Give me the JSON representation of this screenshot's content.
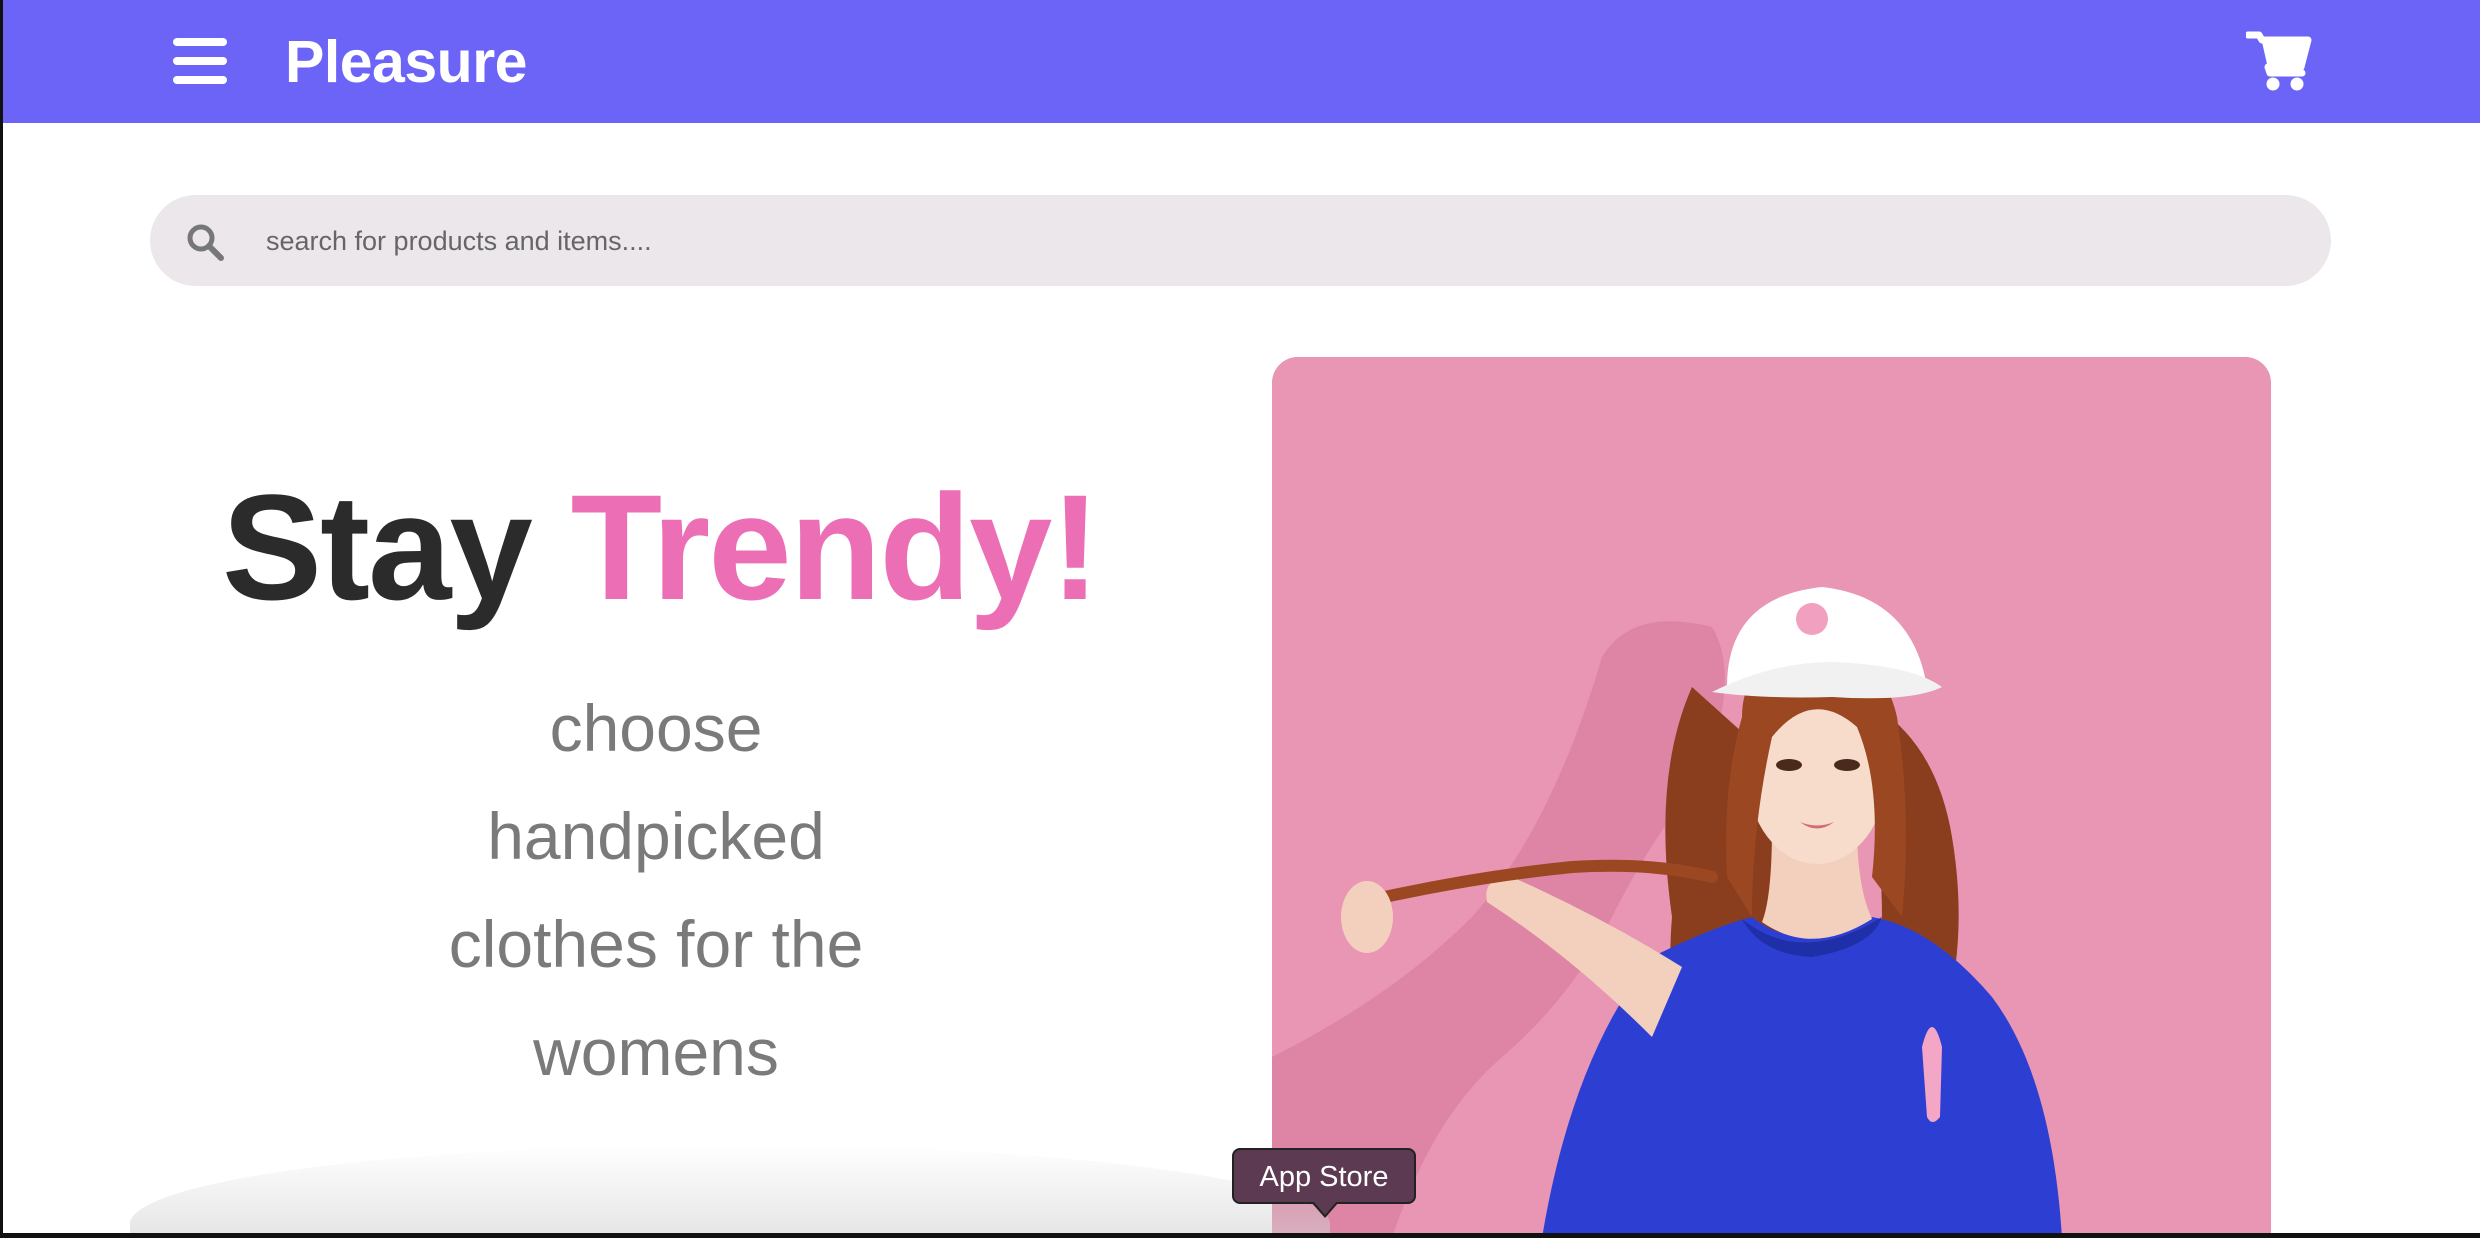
{
  "header": {
    "brand": "Pleasure",
    "menu_icon": "hamburger-menu-icon",
    "cart_icon": "shopping-cart-icon",
    "background_color": "#6c64f6"
  },
  "search": {
    "placeholder": "search for products and items....",
    "value": "",
    "icon": "search-icon"
  },
  "hero": {
    "title_part1": "Stay",
    "title_part2": "Trendy!",
    "subtitle_lines": [
      "choose",
      "handpicked",
      "clothes for the",
      "womens"
    ],
    "accent_color": "#ec6fb6",
    "title_color": "#2b2b2b"
  },
  "tooltip": {
    "text": "App Store"
  }
}
